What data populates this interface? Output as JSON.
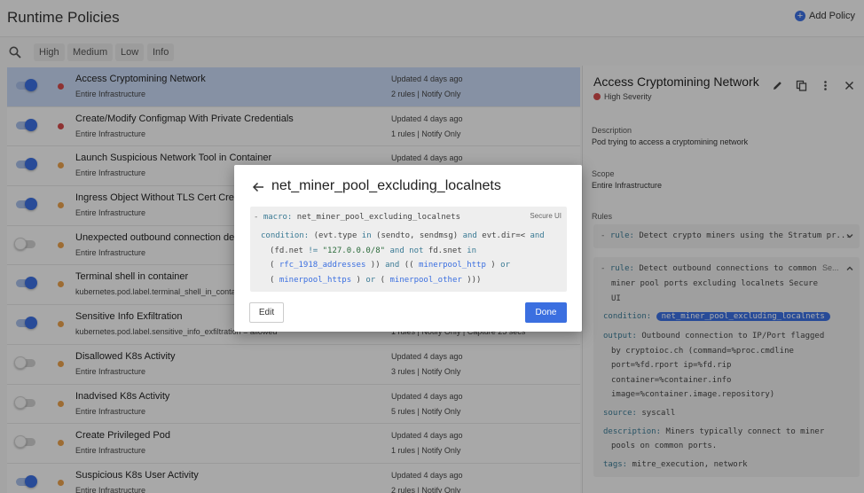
{
  "header": {
    "title": "Runtime Policies",
    "add_policy_label": "Add Policy"
  },
  "filters": {
    "chips": [
      "High",
      "Medium",
      "Low",
      "Info"
    ]
  },
  "policies": [
    {
      "name": "Access Cryptomining Network",
      "scope": "Entire Infrastructure",
      "updated": "Updated 4 days ago",
      "meta": "2 rules | Notify Only",
      "severity": "high",
      "enabled": true
    },
    {
      "name": "Create/Modify Configmap With Private Credentials",
      "scope": "Entire Infrastructure",
      "updated": "Updated 4 days ago",
      "meta": "1 rules | Notify Only",
      "severity": "high",
      "enabled": true
    },
    {
      "name": "Launch Suspicious Network Tool in Container",
      "scope": "Entire Infrastructure",
      "updated": "Updated 4 days ago",
      "meta": "",
      "severity": "medium",
      "enabled": true
    },
    {
      "name": "Ingress Object Without TLS Cert Created",
      "scope": "Entire Infrastructure",
      "updated": "",
      "meta": "",
      "severity": "medium",
      "enabled": true
    },
    {
      "name": "Unexpected outbound connection dest",
      "scope": "Entire Infrastructure",
      "updated": "",
      "meta": "",
      "severity": "medium",
      "enabled": false
    },
    {
      "name": "Terminal shell in container",
      "scope": "kubernetes.pod.label.terminal_shell_in_contai",
      "updated": "",
      "meta": "",
      "severity": "medium",
      "enabled": true
    },
    {
      "name": "Sensitive Info Exfiltration",
      "scope": "kubernetes.pod.label.sensitive_info_exfiltration = allowed",
      "updated": "",
      "meta": "1 rules | Notify Only | Capture 25 secs",
      "severity": "medium",
      "enabled": true
    },
    {
      "name": "Disallowed K8s Activity",
      "scope": "Entire Infrastructure",
      "updated": "Updated 4 days ago",
      "meta": "3 rules | Notify Only",
      "severity": "medium",
      "enabled": false
    },
    {
      "name": "Inadvised K8s Activity",
      "scope": "Entire Infrastructure",
      "updated": "Updated 4 days ago",
      "meta": "5 rules | Notify Only",
      "severity": "medium",
      "enabled": false
    },
    {
      "name": "Create Privileged Pod",
      "scope": "Entire Infrastructure",
      "updated": "Updated 4 days ago",
      "meta": "1 rules | Notify Only",
      "severity": "medium",
      "enabled": false
    },
    {
      "name": "Suspicious K8s User Activity",
      "scope": "Entire Infrastructure",
      "updated": "Updated 4 days ago",
      "meta": "2 rules | Notify Only",
      "severity": "medium",
      "enabled": true
    }
  ],
  "detail": {
    "title": "Access Cryptomining Network",
    "severity_label": "High Severity",
    "description_label": "Description",
    "description": "Pod trying to access a cryptomining network",
    "scope_label": "Scope",
    "scope": "Entire Infrastructure",
    "rules_label": "Rules",
    "rule1": {
      "key": "rule:",
      "value": "Detect crypto miners using the Stratum pr..."
    },
    "rule2": {
      "key": "rule:",
      "value_lines": [
        "Detect outbound connections to common",
        "miner pool ports excluding localnets Secure",
        "UI"
      ],
      "source_badge": "Se...",
      "condition_key": "condition:",
      "condition_tag": "net_miner_pool_excluding_localnets",
      "output_key": "output:",
      "output_lines": [
        "Outbound connection to IP/Port flagged",
        "by cryptoioc.ch (command=%proc.cmdline",
        "port=%fd.rport ip=%fd.rip",
        "container=%container.info",
        "image=%container.image.repository)"
      ],
      "source_key": "source:",
      "source_value": "syscall",
      "description_key": "description:",
      "description_lines": [
        "Miners typically connect to miner",
        "pools on common ports."
      ],
      "tags_key": "tags:",
      "tags_value": "mitre_execution, network"
    }
  },
  "modal": {
    "title": "net_miner_pool_excluding_localnets",
    "source": "Secure UI",
    "macro_key": "macro:",
    "macro_name": "net_miner_pool_excluding_localnets",
    "condition_key": "condition:",
    "line1_a": "(evt.type ",
    "line1_in": "in",
    "line1_b": " (sendto, sendmsg) ",
    "line1_and": "and",
    "line1_c": " evt.dir=< ",
    "line1_and2": "and",
    "line2_a": "(fd.net ",
    "line2_op": "!=",
    "line2_str": " \"127.0.0.0/8\" ",
    "line2_and": "and not",
    "line2_b": " fd.snet ",
    "line2_in": "in",
    "line3_a": "( ",
    "line3_link1": "rfc_1918_addresses",
    "line3_b": " )) ",
    "line3_and": "and",
    "line3_c": " (( ",
    "line3_link2": "minerpool_http",
    "line3_d": " ) ",
    "line3_or": "or",
    "line4_a": "( ",
    "line4_link1": "minerpool_https",
    "line4_b": " ) ",
    "line4_or": "or",
    "line4_c": " ( ",
    "line4_link2": "minerpool_other",
    "line4_d": " )))",
    "edit_label": "Edit",
    "done_label": "Done"
  }
}
